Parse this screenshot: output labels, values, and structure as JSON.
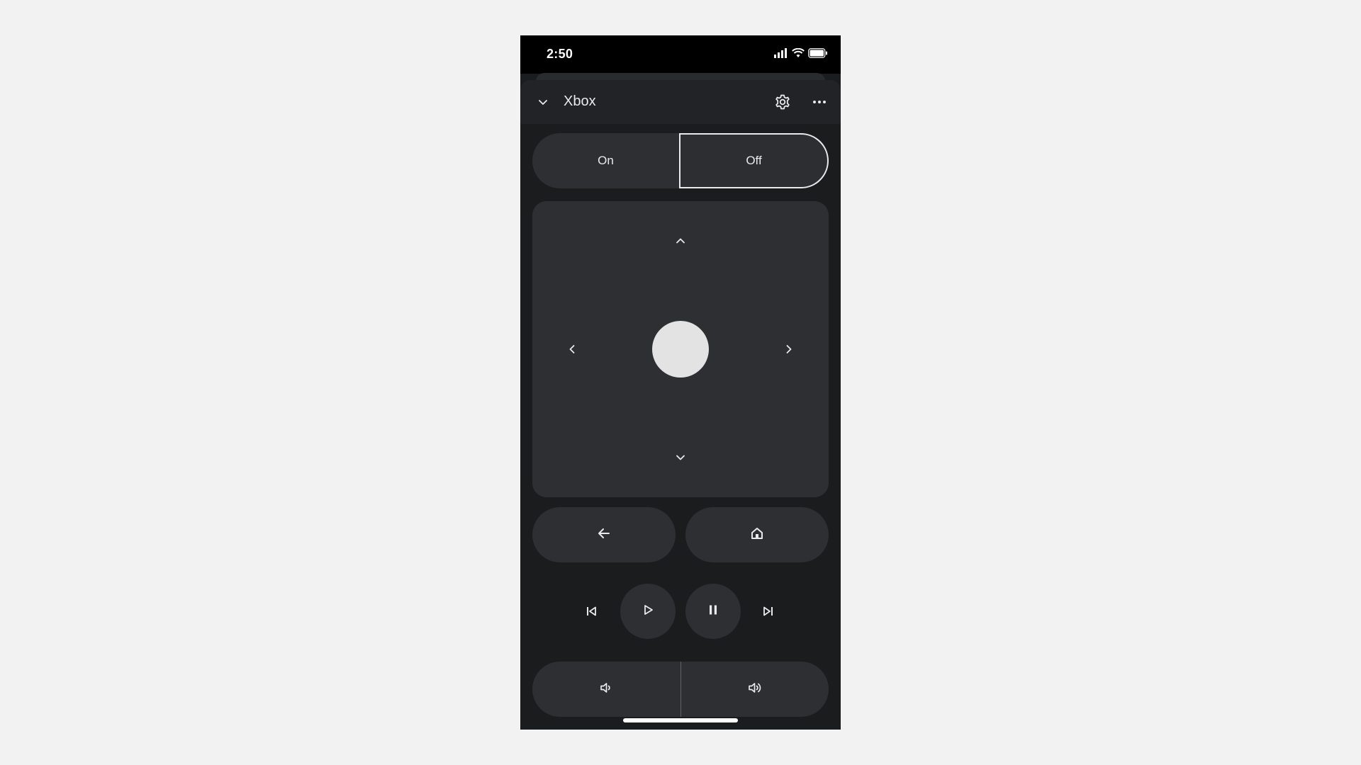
{
  "status_bar": {
    "time": "2:50",
    "icons": [
      "signal-icon",
      "wifi-icon",
      "battery-icon"
    ]
  },
  "header": {
    "title": "Xbox",
    "icons": [
      "chevron-down-icon",
      "gear-icon",
      "more-horizontal-icon"
    ]
  },
  "power": {
    "on_label": "On",
    "off_label": "Off",
    "selected": "Off"
  },
  "dpad": {
    "icons": [
      "chevron-up-icon",
      "chevron-left-icon",
      "chevron-right-icon",
      "chevron-down-icon",
      "select-button"
    ]
  },
  "navigation": {
    "icons": [
      "back-arrow-icon",
      "home-icon"
    ]
  },
  "media": {
    "icons": [
      "skip-previous-icon",
      "play-icon",
      "pause-icon",
      "skip-next-icon"
    ]
  },
  "volume": {
    "icons": [
      "volume-down-icon",
      "volume-up-icon"
    ]
  },
  "colors": {
    "page_background": "#f2f2f2",
    "phone_background": "#1b1c1e",
    "surface": "#2d2f32",
    "text": "#e8eaed",
    "select_button": "#e3e3e3"
  }
}
